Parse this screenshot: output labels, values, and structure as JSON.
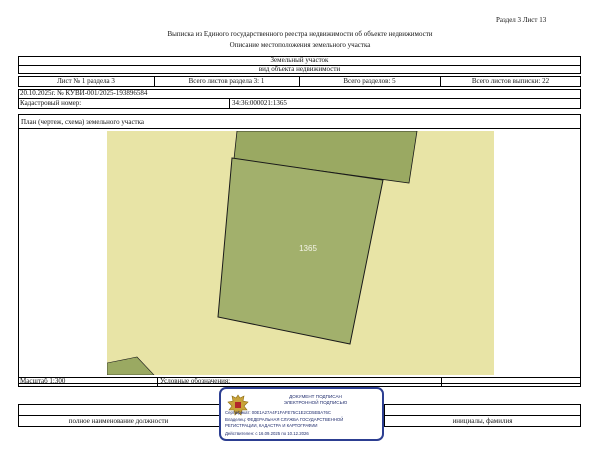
{
  "header": {
    "section_sheet": "Раздел 3   Лист 13",
    "title": "Выписка из Единого государственного реестра недвижимости об объекте недвижимости",
    "subtitle": "Описание местоположения земельного участка"
  },
  "object": {
    "type": "Земельный участок",
    "kind": "вид объекта недвижимости"
  },
  "info_row": {
    "sheet_of_section": "Лист № 1 раздела 3",
    "total_sheets_section": "Всего листов раздела 3: 1",
    "total_sections": "Всего разделов: 5",
    "total_sheets_extract": "Всего листов выписки: 22"
  },
  "doc_id": "20.10.2025г. № КУВИ-001/2025-193896584",
  "cadastral": {
    "label": "Кадастровый номер:",
    "value": "34:36:000021:1365"
  },
  "plan": {
    "title": "План (чертеж, схема) земельного участка",
    "parcel_label": "1365",
    "colors": {
      "background": "#e8e4a6",
      "neighbor": "#9aa962",
      "parcel": "#a2b06c",
      "border": "#1a1a1a"
    }
  },
  "scale": "Масштаб 1:300",
  "legend_label": "Условные обозначения:",
  "signature_block": {
    "col_left": "полное наименование должности",
    "col_right": "инициалы, фамилия"
  },
  "e_signature": {
    "line1": "ДОКУМЕНТ ПОДПИСАН",
    "line2": "ЭЛЕКТРОННОЙ ПОДПИСЬЮ",
    "certificate": "Сертификат: 00E1A27A4F1FAFE75C1E2CD5EBA76C",
    "owner": "Владелец: ФЕДЕРАЛЬНАЯ СЛУЖБА ГОСУДАРСТВЕННОЙ",
    "owner2": "РЕГИСТРАЦИИ, КАДАСТРА И КАРТОГРАФИИ",
    "valid": "Действителен: с 16.09.2025 по 10.12.2026"
  }
}
